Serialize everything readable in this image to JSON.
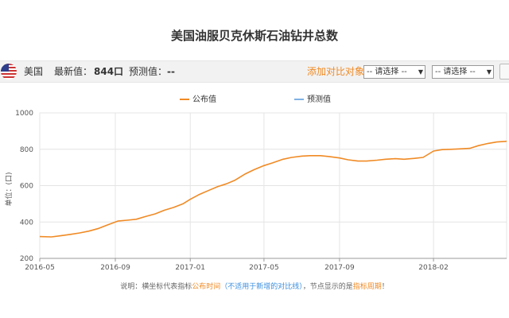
{
  "page": {
    "title": "美国油服贝克休斯石油钻井总数"
  },
  "info_bar": {
    "country": "美国",
    "latest_label": "最新值：",
    "latest_value": "844口",
    "forecast_label": "预测值：",
    "forecast_value": "--",
    "compare_label": "添加对比对象：",
    "select1": "-- 请选择 --",
    "select2": "-- 请选择 --",
    "flag_icon": "us-flag-icon"
  },
  "footnote": {
    "prefix": "说明：横坐标代表指标",
    "highlight1": "公布时间",
    "paren": "（不适用于新增的对比线）",
    "middle": "，节点显示的是",
    "highlight2": "指标周期",
    "suffix": "！"
  },
  "colors": {
    "published": "#f08a24",
    "forecast": "#7fb2e5",
    "grid": "#e4e4e4",
    "highlight": "#f08a24"
  },
  "chart_data": {
    "type": "line",
    "title": "美国油服贝克休斯石油钻井总数",
    "ylabel": "单位：(口)",
    "xlabel": "",
    "ylim": [
      200,
      1000
    ],
    "yticks": [
      200,
      400,
      600,
      800,
      1000
    ],
    "xlim": [
      "2016-05-01",
      "2018-05-31"
    ],
    "xticks": [
      {
        "label": "2016-05",
        "date": "2016-05-01"
      },
      {
        "label": "2016-09",
        "date": "2016-09-01"
      },
      {
        "label": "2017-01",
        "date": "2017-01-01"
      },
      {
        "label": "2017-05",
        "date": "2017-05-01"
      },
      {
        "label": "2017-09",
        "date": "2017-09-01"
      },
      {
        "label": "2018-02",
        "date": "2018-02-01"
      }
    ],
    "grid": true,
    "legend_position": "top-center",
    "series": [
      {
        "name": "公布值",
        "dash": "solid",
        "points": [
          [
            "2016-05-01",
            320
          ],
          [
            "2016-05-20",
            318
          ],
          [
            "2016-06-05",
            325
          ],
          [
            "2016-06-20",
            332
          ],
          [
            "2016-07-05",
            340
          ],
          [
            "2016-07-20",
            350
          ],
          [
            "2016-08-05",
            365
          ],
          [
            "2016-08-20",
            385
          ],
          [
            "2016-09-05",
            405
          ],
          [
            "2016-09-20",
            410
          ],
          [
            "2016-10-05",
            415
          ],
          [
            "2016-10-20",
            430
          ],
          [
            "2016-11-05",
            445
          ],
          [
            "2016-11-20",
            465
          ],
          [
            "2016-12-05",
            480
          ],
          [
            "2016-12-20",
            500
          ],
          [
            "2017-01-01",
            525
          ],
          [
            "2017-01-15",
            550
          ],
          [
            "2017-02-01",
            575
          ],
          [
            "2017-02-15",
            595
          ],
          [
            "2017-03-01",
            610
          ],
          [
            "2017-03-15",
            630
          ],
          [
            "2017-04-01",
            665
          ],
          [
            "2017-04-15",
            688
          ],
          [
            "2017-05-01",
            710
          ],
          [
            "2017-05-15",
            725
          ],
          [
            "2017-06-01",
            745
          ],
          [
            "2017-06-15",
            755
          ],
          [
            "2017-07-01",
            762
          ],
          [
            "2017-07-15",
            765
          ],
          [
            "2017-08-01",
            765
          ],
          [
            "2017-08-15",
            760
          ],
          [
            "2017-09-01",
            752
          ],
          [
            "2017-09-15",
            742
          ],
          [
            "2017-10-01",
            735
          ],
          [
            "2017-10-15",
            735
          ],
          [
            "2017-11-01",
            740
          ],
          [
            "2017-11-15",
            745
          ],
          [
            "2017-12-01",
            748
          ],
          [
            "2017-12-15",
            745
          ],
          [
            "2018-01-01",
            750
          ],
          [
            "2018-01-15",
            755
          ],
          [
            "2018-02-01",
            790
          ],
          [
            "2018-02-15",
            798
          ],
          [
            "2018-03-01",
            800
          ],
          [
            "2018-03-15",
            802
          ],
          [
            "2018-04-01",
            805
          ],
          [
            "2018-04-15",
            820
          ],
          [
            "2018-05-01",
            832
          ],
          [
            "2018-05-15",
            840
          ],
          [
            "2018-05-31",
            844
          ]
        ]
      },
      {
        "name": "预测值",
        "dash": "dashed",
        "points": []
      }
    ]
  }
}
